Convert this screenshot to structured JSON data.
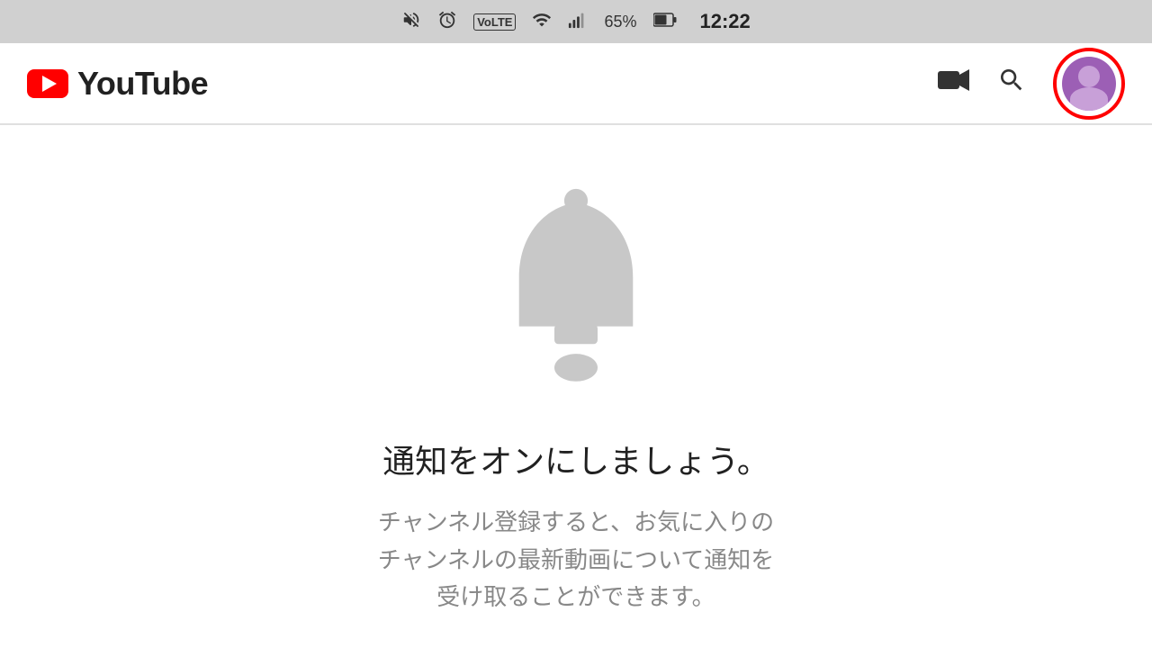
{
  "statusBar": {
    "time": "12:22",
    "battery": "65%",
    "icons": [
      "mute-icon",
      "alarm-icon",
      "volte-icon",
      "wifi-icon",
      "signal-icon",
      "battery-icon"
    ]
  },
  "navbar": {
    "logo": "YouTube",
    "icons": {
      "camera": "video-camera",
      "search": "search",
      "avatar": "user-avatar"
    }
  },
  "mainContent": {
    "title": "通知をオンにしましょう。",
    "subtitle_line1": "チャンネル登録すると、お気に入りの",
    "subtitle_line2": "チャンネルの最新動画について通知を",
    "subtitle_line3": "受け取ることができます。"
  }
}
